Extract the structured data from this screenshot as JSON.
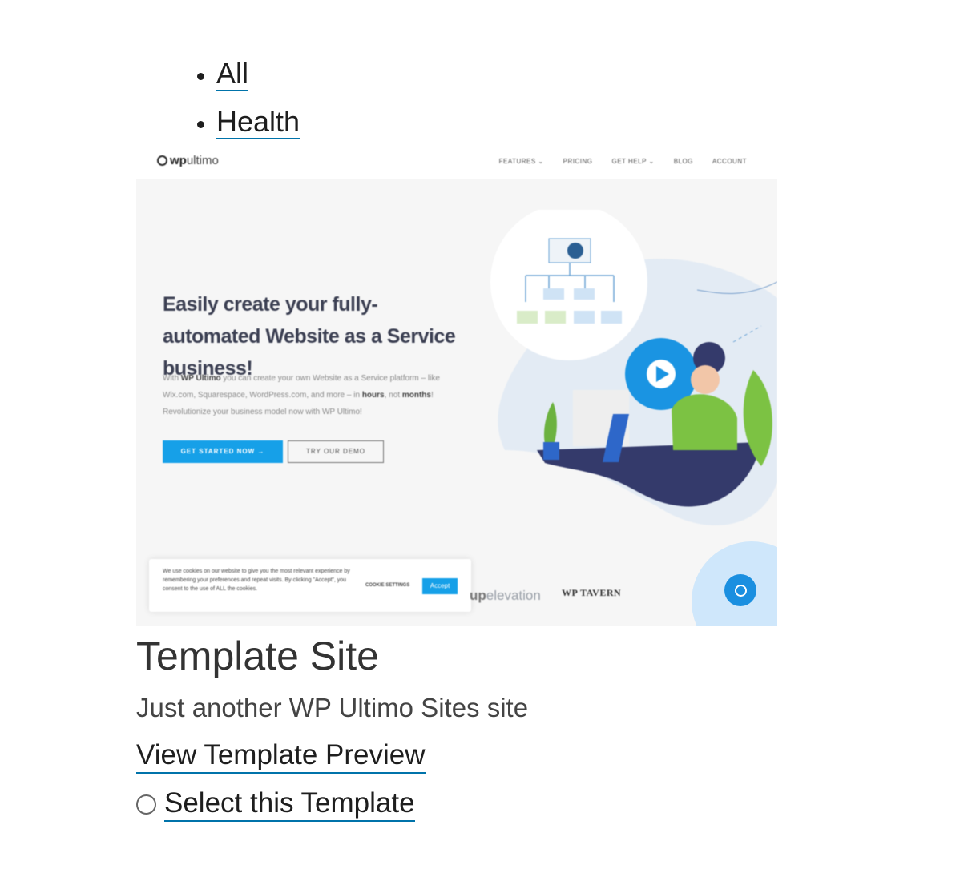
{
  "filters": [
    "All",
    "Health"
  ],
  "preview": {
    "logo_bold": "wp",
    "logo_rest": "ultimo",
    "nav": [
      "FEATURES ⌄",
      "PRICING",
      "GET HELP ⌄",
      "BLOG",
      "ACCOUNT"
    ],
    "headline": "Easily create your fully-automated Website as a Service business!",
    "body_1": "With ",
    "body_brand": "WP Ultimo",
    "body_2": " you can create your own Website as a Service platform – like Wix.com, Squarespace, WordPress.com, and more – in ",
    "body_hours": "hours",
    "body_3": ", not ",
    "body_months": "months",
    "body_4": "! Revolutionize your business model now with WP Ultimo!",
    "cta_primary": "GET STARTED NOW →",
    "cta_secondary": "TRY OUR DEMO",
    "cookie_text": "We use cookies on our website to give you the most relevant experience by remembering your preferences and repeat visits. By clicking \"Accept\", you consent to the use of ALL the cookies.",
    "cookie_settings": "COOKIE SETTINGS",
    "cookie_accept": "Accept",
    "partner_1_bold": "up",
    "partner_1_rest": "elevation",
    "partner_2": "WP TAVERN"
  },
  "template": {
    "title": "Template Site",
    "subtitle": "Just another WP Ultimo Sites site",
    "preview_link": "View Template Preview",
    "select_label": "Select this Template"
  },
  "colors": {
    "link_underline": "#0073aa",
    "accent_blue": "#16a0e8",
    "navy": "#343a6b",
    "green": "#7cc243"
  }
}
